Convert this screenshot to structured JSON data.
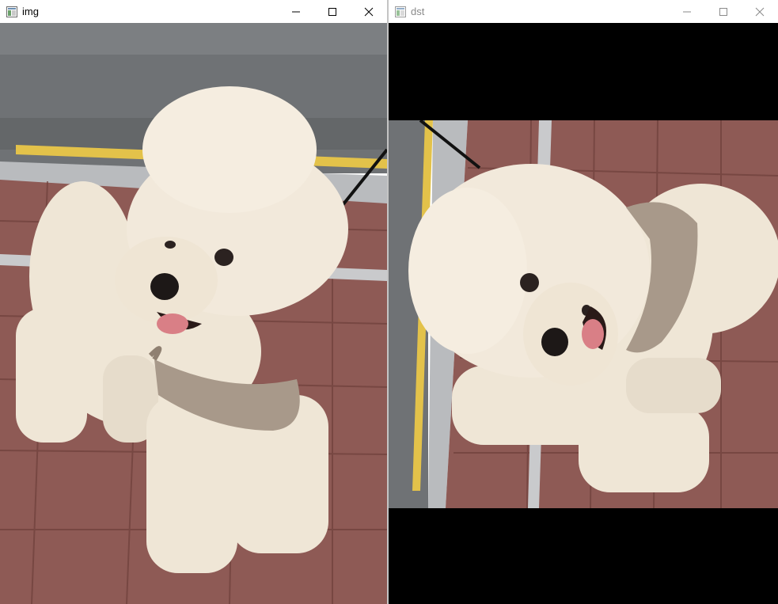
{
  "windows": {
    "left": {
      "title": "img"
    },
    "right": {
      "title": "dst"
    }
  },
  "icons": {
    "app": "opencv-window-icon",
    "minimize": "minimize-icon",
    "maximize": "maximize-icon",
    "close": "close-icon"
  },
  "colors": {
    "titlebar_bg": "#ffffff",
    "asphalt": "#6f7275",
    "curb_yellow": "#e3c24a",
    "brick": "#8e5a55",
    "fur": "#efe6d6",
    "harness": "#a8998a",
    "letterbox": "#000000"
  }
}
